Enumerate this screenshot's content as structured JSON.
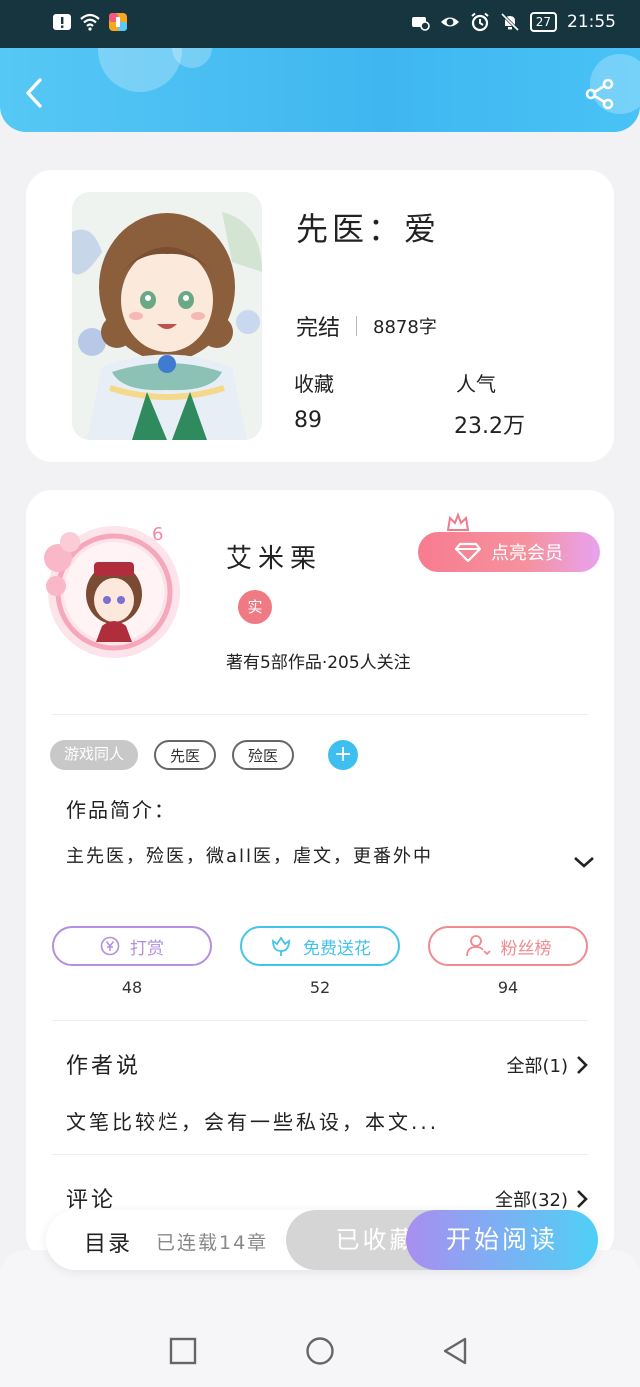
{
  "status_bar": {
    "time": "21:55",
    "battery": "27"
  },
  "header": {
    "back_icon": "chevron-left-icon",
    "share_icon": "share-icon"
  },
  "book": {
    "title": "先医：爱",
    "status": "完结",
    "word_count": "8878字",
    "favorites_label": "收藏",
    "favorites_value": "89",
    "popularity_label": "人气",
    "popularity_value": "23.2万"
  },
  "author": {
    "name": "艾米栗",
    "verify_badge": "实",
    "level": "6",
    "stats": "著有5部作品·205人关注",
    "vip_button": "点亮会员"
  },
  "tags": [
    {
      "label": "游戏同人",
      "style": "filled"
    },
    {
      "label": "先医",
      "style": "outline"
    },
    {
      "label": "殓医",
      "style": "outline"
    }
  ],
  "intro": {
    "heading": "作品简介：",
    "text": "主先医，殓医，微all医，虐文，更番外中"
  },
  "actions": [
    {
      "label": "打赏",
      "count": "48",
      "icon": "yen-coin-icon",
      "color": "#b48fdc"
    },
    {
      "label": "免费送花",
      "count": "52",
      "icon": "flower-icon",
      "color": "#43c3ec"
    },
    {
      "label": "粉丝榜",
      "count": "94",
      "icon": "user-rank-icon",
      "color": "#f08a8f"
    }
  ],
  "author_say": {
    "heading": "作者说",
    "more": "全部(1)",
    "text": "文笔比较烂，会有一些私设，本文..."
  },
  "comments": {
    "heading": "评论",
    "more": "全部(32)"
  },
  "bottom_bar": {
    "toc": "目录",
    "chapters": "已连载14章",
    "collected": "已收藏",
    "start_read": "开始阅读"
  },
  "colors": {
    "header": "#3fb6f0",
    "status_bar": "#16353f",
    "accent_pink": "#f77c8f"
  }
}
